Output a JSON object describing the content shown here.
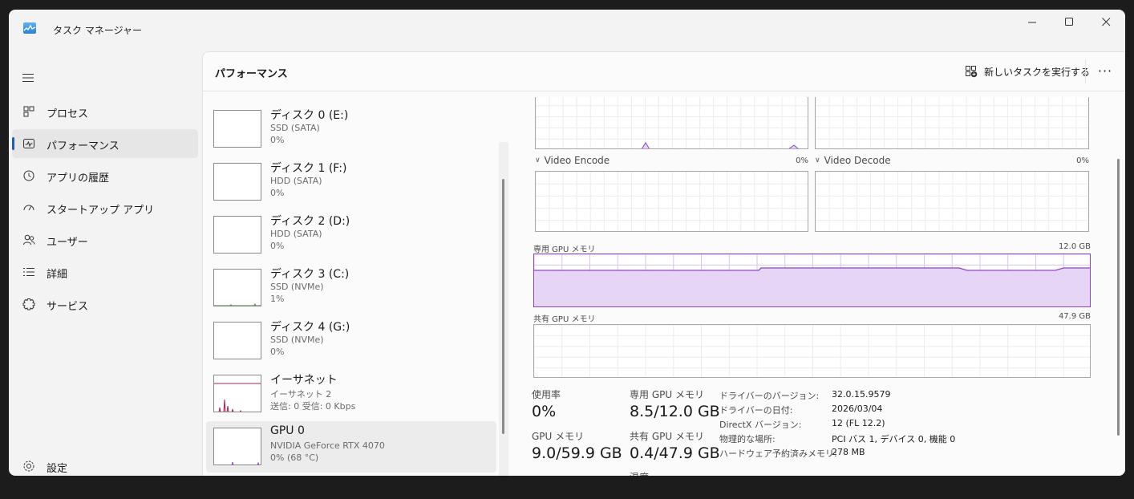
{
  "window": {
    "title": "タスク マネージャー"
  },
  "nav": {
    "items": [
      {
        "label": "プロセス",
        "icon": "processes-icon"
      },
      {
        "label": "パフォーマンス",
        "icon": "performance-icon",
        "active": true
      },
      {
        "label": "アプリの履歴",
        "icon": "history-icon"
      },
      {
        "label": "スタートアップ アプリ",
        "icon": "startup-icon"
      },
      {
        "label": "ユーザー",
        "icon": "users-icon"
      },
      {
        "label": "詳細",
        "icon": "details-icon"
      },
      {
        "label": "サービス",
        "icon": "services-icon"
      }
    ],
    "settings_label": "設定"
  },
  "header": {
    "title": "パフォーマンス",
    "new_task_label": "新しいタスクを実行する",
    "more_label": "···"
  },
  "resources": [
    {
      "title": "ディスク 0 (E:)",
      "subtitle": "SSD (SATA)",
      "value": "0%"
    },
    {
      "title": "ディスク 1 (F:)",
      "subtitle": "HDD (SATA)",
      "value": "0%"
    },
    {
      "title": "ディスク 2 (D:)",
      "subtitle": "HDD (SATA)",
      "value": "0%"
    },
    {
      "title": "ディスク 3 (C:)",
      "subtitle": "SSD (NVMe)",
      "value": "1%"
    },
    {
      "title": "ディスク 4 (G:)",
      "subtitle": "SSD (NVMe)",
      "value": "0%"
    },
    {
      "title": "イーサネット",
      "subtitle": "イーサネット 2",
      "value": "送信: 0 受信: 0 Kbps"
    },
    {
      "title": "GPU 0",
      "subtitle": "NVIDIA GeForce RTX 4070",
      "value": "0% (68 °C)",
      "selected": true
    }
  ],
  "detail": {
    "engines": [
      {
        "label": "Video Encode",
        "pct": "0%"
      },
      {
        "label": "Video Decode",
        "pct": "0%"
      }
    ],
    "dedicated_mem": {
      "label": "専用 GPU メモリ",
      "max": "12.0 GB",
      "used_fraction": 0.7
    },
    "shared_mem": {
      "label": "共有 GPU メモリ",
      "max": "47.9 GB"
    },
    "stats": {
      "usage_label": "使用率",
      "usage_value": "0%",
      "ded_label": "専用 GPU メモリ",
      "ded_value": "8.5/12.0 GB",
      "gpu_mem_label": "GPU メモリ",
      "gpu_mem_value": "9.0/59.9 GB",
      "shared_label": "共有 GPU メモリ",
      "shared_value": "0.4/47.9 GB",
      "temp_label": "温度"
    },
    "info": [
      {
        "k": "ドライバーのバージョン:",
        "v": "32.0.15.9579"
      },
      {
        "k": "ドライバーの日付:",
        "v": "2026/03/04"
      },
      {
        "k": "DirectX バージョン:",
        "v": "12 (FL 12.2)"
      },
      {
        "k": "物理的な場所:",
        "v": "PCI バス 1, デバイス 0, 機能 0"
      },
      {
        "k": "ハードウェア予約済みメモリ:",
        "v": "278 MB"
      }
    ]
  },
  "colors": {
    "accent": "#1a5fb4",
    "gpu_graph": "#8e44c8",
    "gpu_fill": "#e6d5f5",
    "net_graph": "#b0204a"
  }
}
